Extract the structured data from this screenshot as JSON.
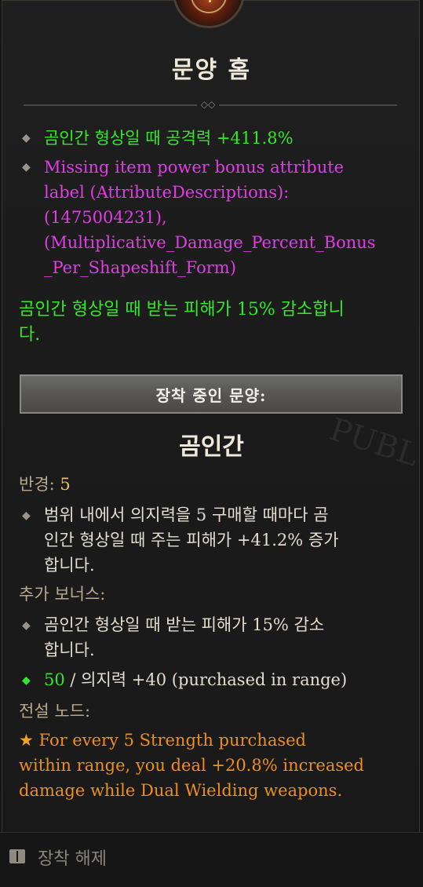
{
  "item": {
    "title": "문양 홈"
  },
  "affixes": [
    {
      "bullet": "◆",
      "text": "곰인간 형상일 때 공격력 +411.8%"
    },
    {
      "bullet": "◆",
      "lines": [
        "Missing item power bonus attribute",
        "label (AttributeDescriptions):",
        "(1475004231),",
        "(Multiplicative_Damage_Percent_Bonus",
        "_Per_Shapeshift_Form)"
      ]
    }
  ],
  "implicit": {
    "line1": "곰인간 형상일 때 받는 피해가 15% 감소합니",
    "line2": "다."
  },
  "socket_button": {
    "label": "장착 중인 문양:"
  },
  "glyph": {
    "name": "곰인간",
    "radius_label": "반경:",
    "radius_value": "5",
    "effect_bullet": "◆",
    "effect_lines": [
      "범위 내에서 의지력을 5 구매할 때마다 곰",
      "인간 형상일 때 주는 피해가 +41.2% 증가",
      "합니다."
    ],
    "additional_bonus_label": "추가 보너스:",
    "bonus_bullet": "◆",
    "bonus_lines": [
      "곰인간 형상일 때 받는 피해가 15% 감소",
      "합니다."
    ],
    "req_bullet": "◆",
    "req_current": "50",
    "req_rest": " / 의지력 +40 (purchased in range)",
    "legendary_label": "전설 노드:",
    "legendary_star": "★",
    "legendary_lines": [
      "For every 5 Strength purchased",
      "within range, you deal +20.8% increased",
      "damage while Dual Wielding weapons."
    ]
  },
  "watermark": "PUBL",
  "footer": {
    "icon": "book-icon",
    "label": "장착 해제"
  },
  "colors": {
    "affix_green": "#35e82a",
    "affix_magenta": "#e13ce6",
    "legendary_orange": "#ef8e1c",
    "label_tan": "#b7a88e"
  }
}
